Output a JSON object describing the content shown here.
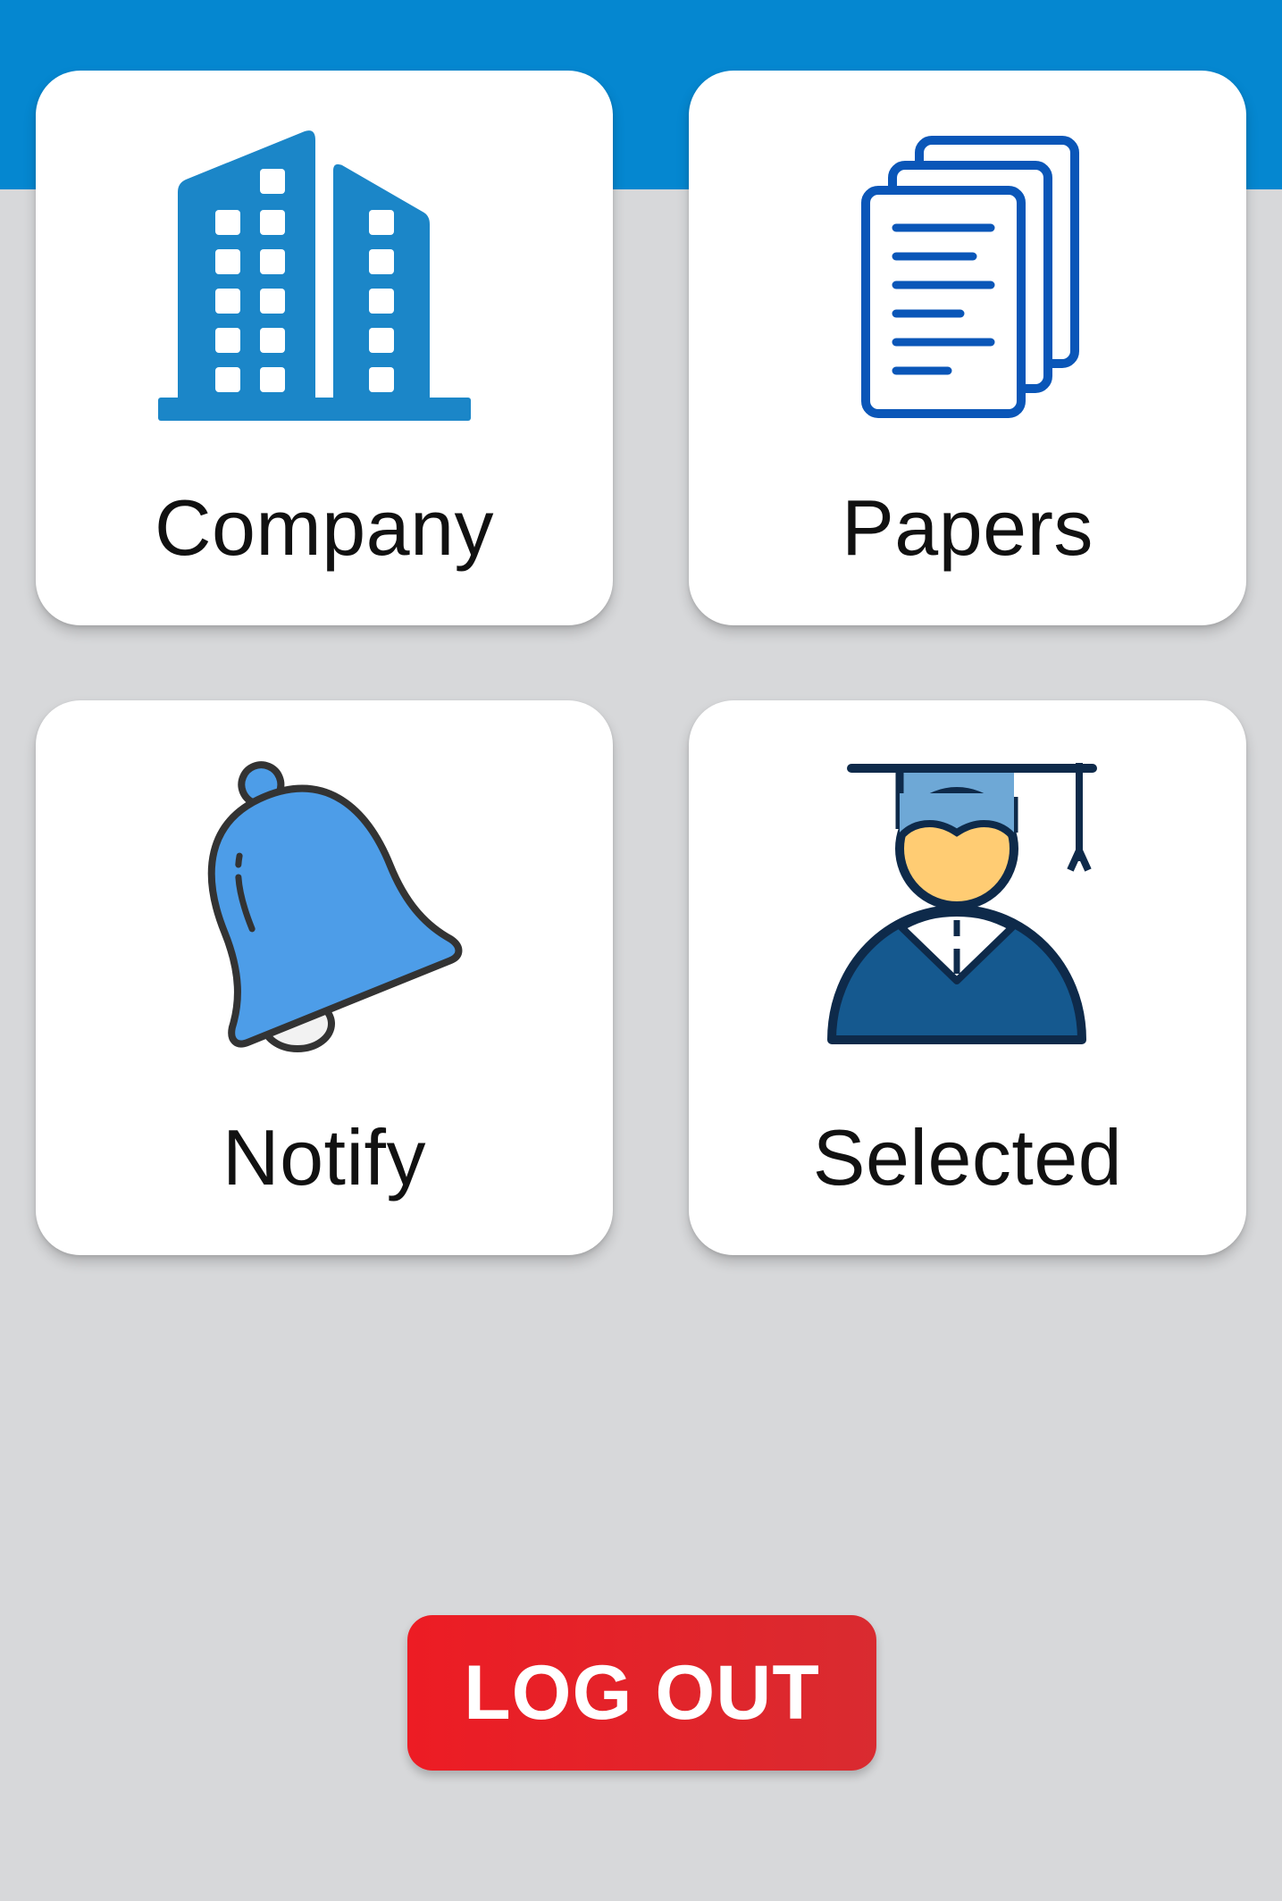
{
  "header": {
    "color": "#0587d0"
  },
  "menu": {
    "items": [
      {
        "label": "Company",
        "icon": "building-icon"
      },
      {
        "label": "Papers",
        "icon": "documents-icon"
      },
      {
        "label": "Notify",
        "icon": "bell-icon"
      },
      {
        "label": "Selected",
        "icon": "graduate-icon"
      }
    ]
  },
  "logout": {
    "label": "LOG OUT",
    "color": "#ed1c24"
  }
}
